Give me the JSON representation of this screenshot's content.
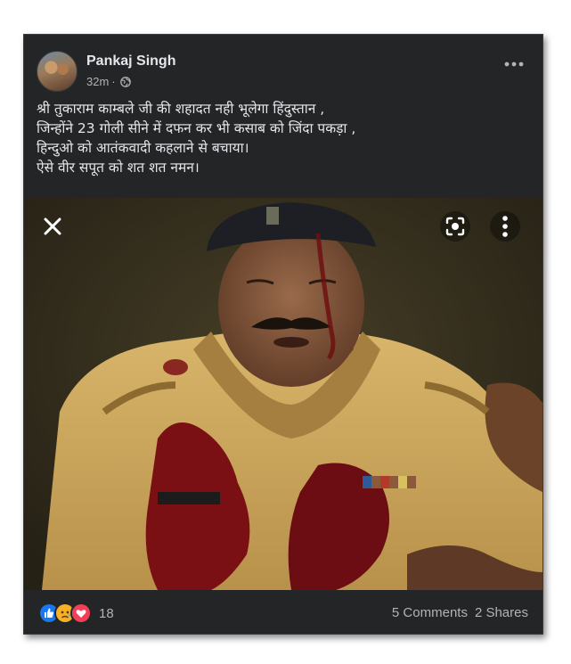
{
  "post": {
    "author": "Pankaj Singh",
    "time": "32m",
    "separator": "·",
    "caption": "श्री तुकाराम काम्बले जी की शहादत नही भूलेगा हिंदुस्तान ,\nजिन्होंने 23 गोली सीने में दफन कर भी कसाब को जिंदा पकड़ा ,\nहिन्दुओ को आतंकवादी कहलाने से बचाया।\nऐसे वीर सपूत को शत शत नमन।",
    "reaction_count": "18",
    "comments": "5 Comments",
    "shares": "2 Shares",
    "reactions": [
      "like-icon",
      "sad-icon",
      "love-icon"
    ]
  },
  "colors": {
    "card": "#242526",
    "text": "#e4e6eb",
    "secondary": "#b0b3b8",
    "like": "#1877f2",
    "love": "#f33e58",
    "sad": "#f7b125"
  }
}
